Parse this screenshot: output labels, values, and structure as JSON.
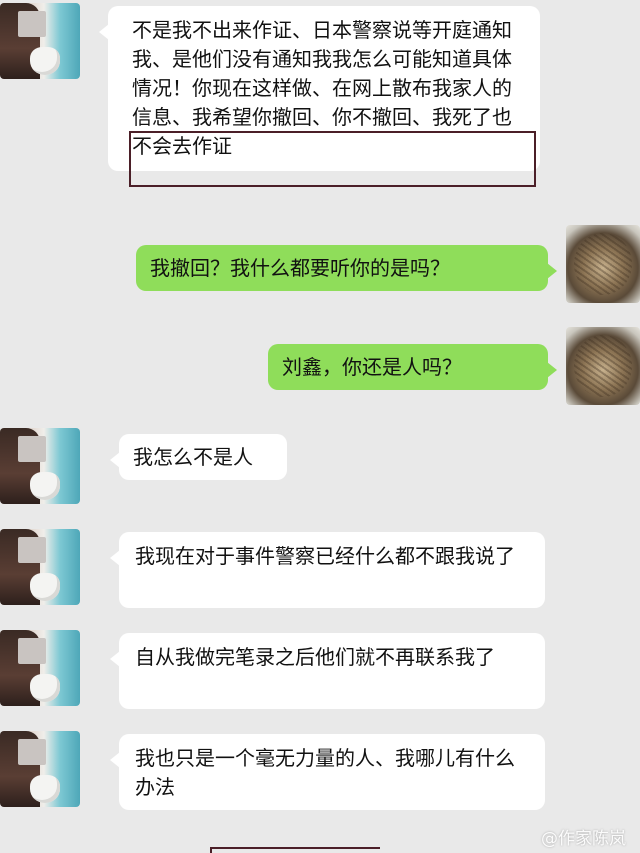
{
  "messages": [
    {
      "side": "left",
      "avatar": "girl-avatar",
      "text": "不是我不出来作证、日本警察说等开庭通知我、是他们没有通知我我怎么可能知道具体情况！你现在这样做、在网上散布我家人的信息、我希望你撤回、你不撤回、我死了也不会去作证"
    },
    {
      "side": "right",
      "avatar": "hedgehog-avatar",
      "text": "我撤回？我什么都要听你的是吗？"
    },
    {
      "side": "right",
      "avatar": "hedgehog-avatar",
      "text": "刘鑫，你还是人吗？"
    },
    {
      "side": "left",
      "avatar": "girl-avatar",
      "text": "我怎么不是人"
    },
    {
      "side": "left",
      "avatar": "girl-avatar",
      "text": "我现在对于事件警察已经什么都不跟我说了"
    },
    {
      "side": "left",
      "avatar": "girl-avatar",
      "text": "自从我做完笔录之后他们就不再联系我了"
    },
    {
      "side": "left",
      "avatar": "girl-avatar",
      "text": "我也只是一个毫无力量的人、我哪儿有什么办法"
    }
  ],
  "watermark": "@作家陈岚",
  "colors": {
    "background": "#e9e9e9",
    "left_bubble": "#ffffff",
    "right_bubble": "#8fdd5a",
    "highlight_border": "#4b1f28"
  }
}
